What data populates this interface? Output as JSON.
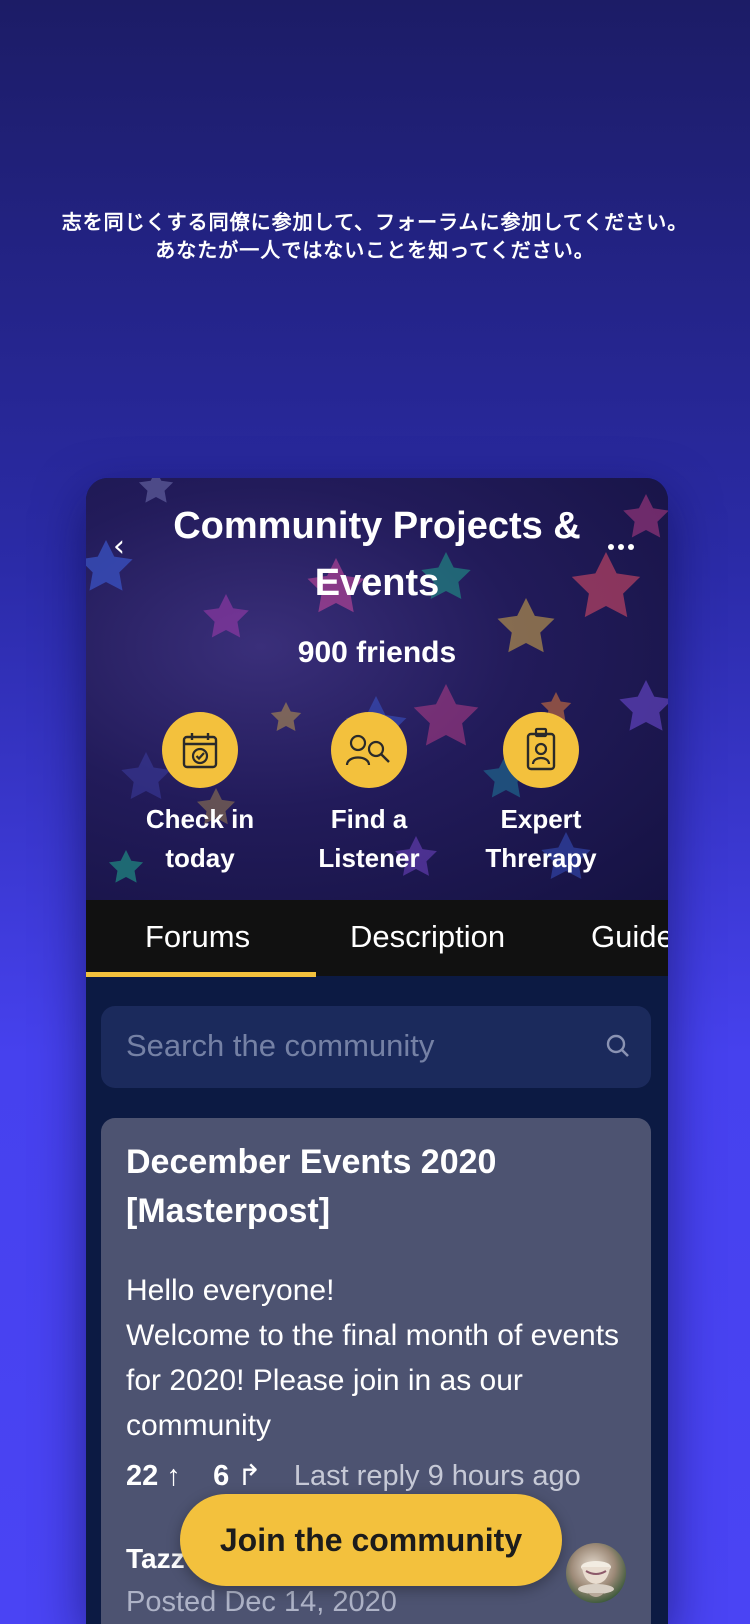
{
  "promo": {
    "line1": "志を同じくする同僚に参加して、フォーラムに参加してください。",
    "line2": "あなたが一人ではないことを知ってください。"
  },
  "header": {
    "back_icon": "‹",
    "title": "Community Projects & Events",
    "friends": "900 friends",
    "more_icon": "more-dots-icon"
  },
  "actions": [
    {
      "label": "Check in today",
      "icon": "calendar-check-icon"
    },
    {
      "label": "Find a Listener",
      "icon": "people-search-icon"
    },
    {
      "label": "Expert Threrapy",
      "icon": "id-badge-icon"
    }
  ],
  "tabs": [
    {
      "label": "Forums",
      "active": true
    },
    {
      "label": "Description",
      "active": false
    },
    {
      "label": "Guide",
      "active": false
    }
  ],
  "search": {
    "placeholder": "Search the community",
    "icon": "search-icon"
  },
  "post": {
    "title": "December Events 2020 [Masterpost]",
    "body_line1": "Hello everyone!",
    "body_line2": "Welcome to the final month of events for 2020! Please join in as our community",
    "upvotes": "22",
    "upvote_icon": "↑",
    "shares": "6",
    "share_icon": "↱",
    "last_reply": "Last reply 9 hours ago",
    "author": "Tazz",
    "posted": "Posted Dec 14, 2020"
  },
  "cta": {
    "join_label": "Join the community"
  },
  "colors": {
    "accent": "#f3c13d",
    "background_bottom": "#4a44f4",
    "tab_bar": "#111111",
    "card": "#4d5371"
  }
}
